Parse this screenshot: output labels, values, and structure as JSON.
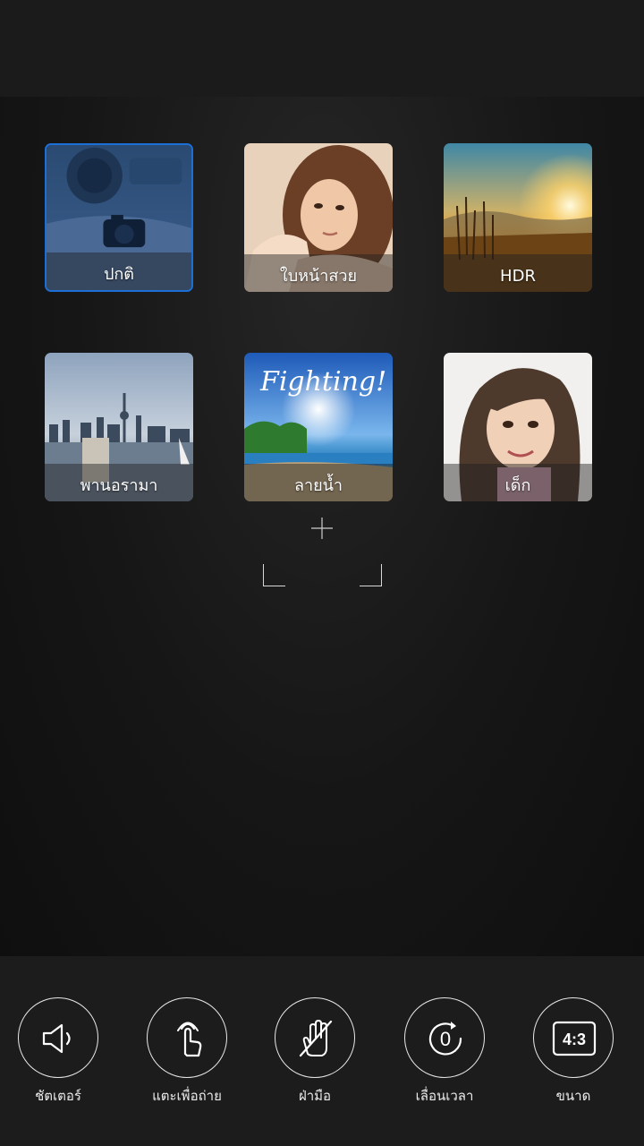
{
  "modes": [
    {
      "id": "normal",
      "label": "ปกติ",
      "selected": true
    },
    {
      "id": "beauty",
      "label": "ใบหน้าสวย",
      "selected": false
    },
    {
      "id": "hdr",
      "label": "HDR",
      "selected": false
    },
    {
      "id": "panorama",
      "label": "พานอรามา",
      "selected": false
    },
    {
      "id": "watermark",
      "label": "ลายน้ำ",
      "selected": false,
      "overlay_text": "Fighting!"
    },
    {
      "id": "kids",
      "label": "เด็ก",
      "selected": false
    }
  ],
  "controls": [
    {
      "id": "shutter-sound",
      "label": "ชัตเตอร์",
      "icon": "speaker-icon"
    },
    {
      "id": "touch-capture",
      "label": "แตะเพื่อถ่าย",
      "icon": "touch-icon"
    },
    {
      "id": "gesture",
      "label": "ฝ่ามือ",
      "icon": "palm-icon"
    },
    {
      "id": "timer",
      "label": "เลื่อนเวลา",
      "icon": "timer-icon",
      "value": "0"
    },
    {
      "id": "size",
      "label": "ขนาด",
      "icon": "aspect-ratio-icon",
      "value": "4:3"
    }
  ],
  "colors": {
    "accent": "#1d6fd8",
    "bar": "#1c1c1c"
  }
}
